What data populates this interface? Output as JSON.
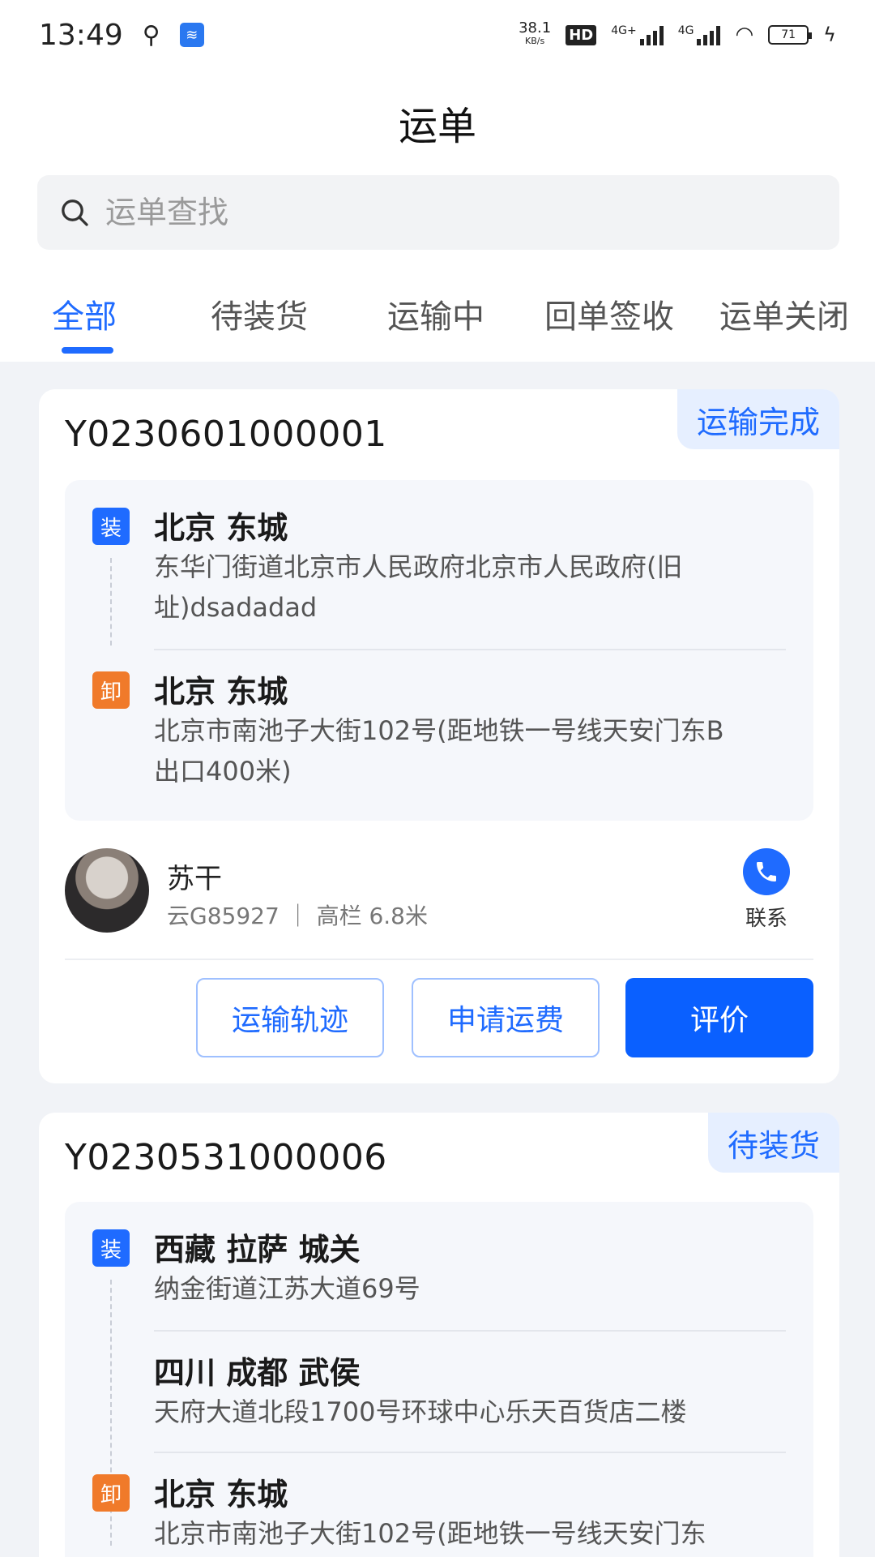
{
  "status_bar": {
    "time": "13:49",
    "net_speed_top": "38.1",
    "net_speed_unit": "KB/s",
    "hd": "HD",
    "sim1": "4G+",
    "sim2": "4G",
    "battery": "71"
  },
  "title": "运单",
  "search": {
    "placeholder": "运单查找"
  },
  "tabs": [
    {
      "label": "全部"
    },
    {
      "label": "待装货"
    },
    {
      "label": "运输中"
    },
    {
      "label": "回单签收"
    },
    {
      "label": "运单关闭"
    }
  ],
  "orders": [
    {
      "number": "Y0230601000001",
      "status": "运输完成",
      "stops": [
        {
          "badge": "装",
          "city": "北京 东城",
          "address": "东华门街道北京市人民政府北京市人民政府(旧址)dsadadad"
        },
        {
          "badge": "卸",
          "city": "北京 东城",
          "address": "北京市南池子大街102号(距地铁一号线天安门东B出口400米)"
        }
      ],
      "driver": {
        "name": "苏干",
        "info": "云G85927 ｜ 高栏 6.8米",
        "contact_label": "联系"
      },
      "buttons": {
        "track": "运输轨迹",
        "apply_fee": "申请运费",
        "rate": "评价"
      }
    },
    {
      "number": "Y0230531000006",
      "status": "待装货",
      "stops": [
        {
          "badge": "装",
          "city": "西藏 拉萨 城关",
          "address": "纳金街道江苏大道69号"
        },
        {
          "badge": "",
          "city": "四川 成都 武侯",
          "address": "天府大道北段1700号环球中心乐天百货店二楼"
        },
        {
          "badge": "卸",
          "city": "北京 东城",
          "address": "北京市南池子大街102号(距地铁一号线天安门东"
        }
      ]
    }
  ]
}
